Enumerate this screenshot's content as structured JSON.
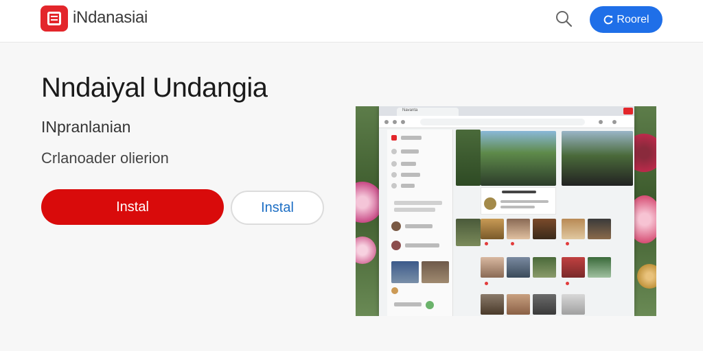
{
  "header": {
    "brand": "iNdanasiai",
    "search_icon": "search-icon",
    "action_button_label": "Roorel",
    "action_button_icon": "refresh-icon",
    "accent_color": "#1f6fe8",
    "logo_color": "#e3262b"
  },
  "hero": {
    "title": "Nndaiyal Undangia",
    "subtitle": "INpranlanian",
    "description": "Crlanoader olierion",
    "primary_button": "Instal",
    "secondary_button": "Instal",
    "primary_color": "#d90b0b",
    "secondary_color": "#1c6ec4"
  },
  "preview": {
    "tab_label": "Navanta"
  }
}
